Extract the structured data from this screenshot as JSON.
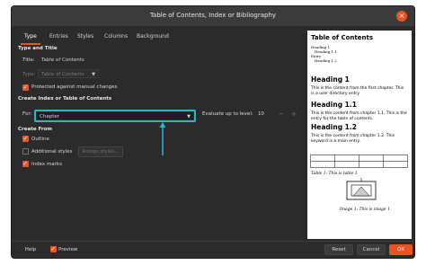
{
  "window": {
    "title": "Table of Contents, Index or Bibliography"
  },
  "tabs": [
    "Type",
    "Entries",
    "Styles",
    "Columns",
    "Background"
  ],
  "type_and_title": {
    "heading": "Type and Title",
    "title_label": "Title:",
    "title_value": "Table of Contents",
    "type_label": "Type:",
    "type_value": "Table of Contents",
    "protected_label": "Protected against manual changes"
  },
  "create_index": {
    "heading": "Create Index or Table of Contents",
    "for_label": "For:",
    "for_value": "Chapter",
    "evaluate_label": "Evaluate up to level:",
    "level_value": "10",
    "minus": "−",
    "plus": "+"
  },
  "create_from": {
    "heading": "Create From",
    "outline": "Outline",
    "additional_styles": "Additional styles",
    "assign_styles": "Assign styles...",
    "index_marks": "Index marks"
  },
  "footer": {
    "help": "Help",
    "preview": "Preview",
    "reset": "Reset",
    "cancel": "Cancel",
    "ok": "OK"
  },
  "preview": {
    "toc_title": "Table of Contents",
    "toc_lines": [
      "Heading 1",
      "Heading 1.1",
      "Entry",
      "Heading 1.2"
    ],
    "h1": "Heading 1",
    "p1": "This is the content from the first chapter. This is a user directory entry.",
    "h11": "Heading 1.1",
    "p11": "This is the content from chapter 1.1. This is the entry for the table of contents.",
    "h12": "Heading 1.2",
    "p12": "This is the content from chapter 1.2. This keyword is a main entry.",
    "table_caption": "Table 1: This is table 1",
    "image_caption": "Image 1: This is image 1"
  },
  "colors": {
    "accent": "#e95420",
    "highlight": "#2ab6c8"
  }
}
